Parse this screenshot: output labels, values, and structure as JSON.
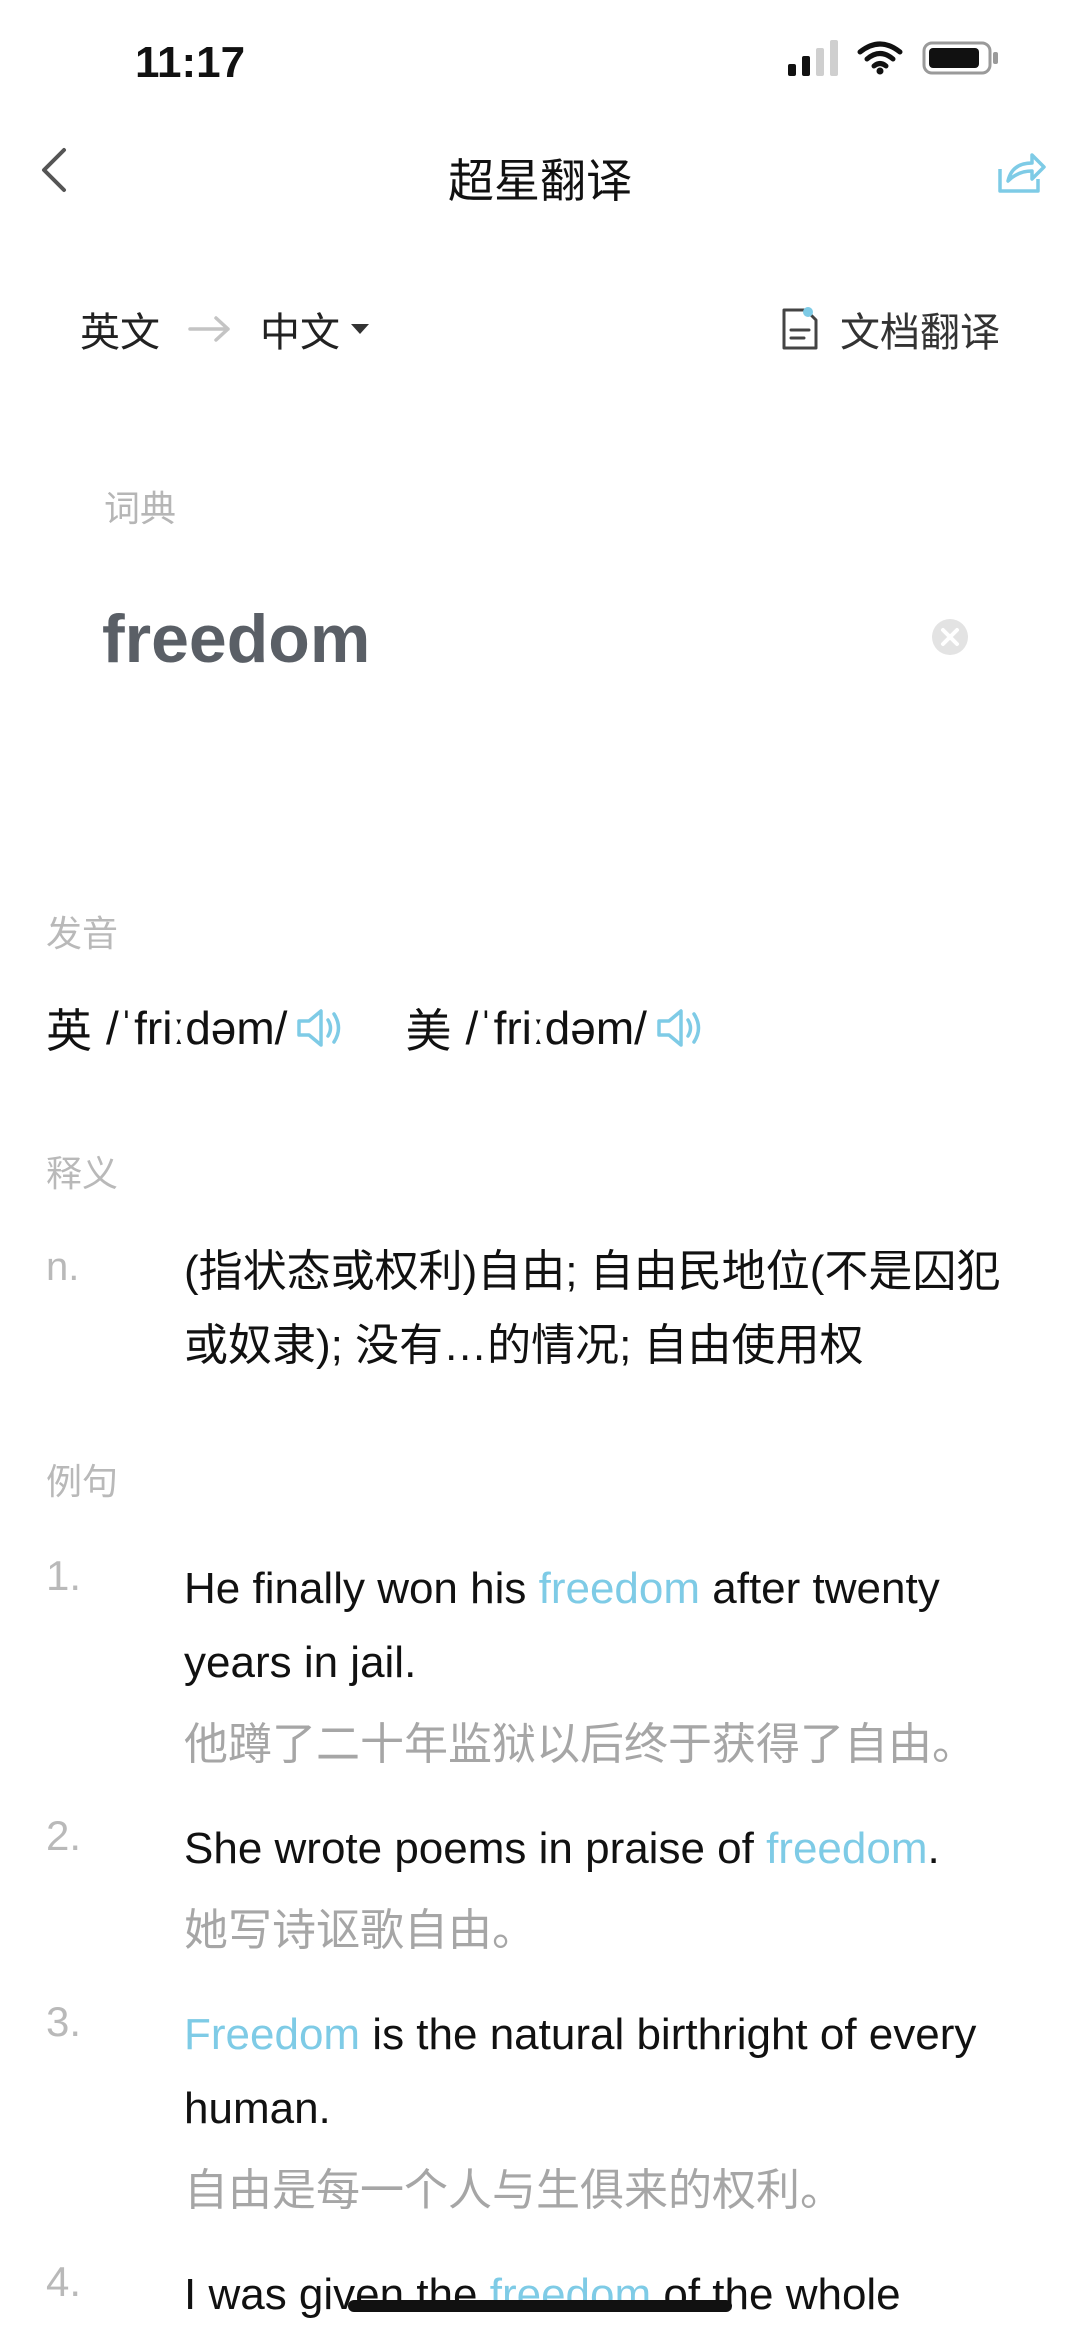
{
  "status": {
    "time": "11:17"
  },
  "nav": {
    "title": "超星翻译"
  },
  "lang": {
    "from": "英文",
    "to": "中文",
    "doc_translate": "文档翻译"
  },
  "input": {
    "label": "词典",
    "word": "freedom"
  },
  "sections": {
    "pronunciation": "发音",
    "definition": "释义",
    "examples": "例句"
  },
  "pronunciations": [
    {
      "region": "英",
      "ipa": "/ˈfriːdəm/"
    },
    {
      "region": "美",
      "ipa": "/ˈfriːdəm/"
    }
  ],
  "definition": {
    "pos": "n.",
    "text": "(指状态或权利)自由; 自由民地位(不是囚犯或奴隶); 没有…的情况; 自由使用权"
  },
  "examples": [
    {
      "num": "1.",
      "before": "He finally won his ",
      "highlight": "freedom",
      "after": " after twenty years in jail.",
      "zh": "他蹲了二十年监狱以后终于获得了自由。"
    },
    {
      "num": "2.",
      "before": "She wrote poems in praise of ",
      "highlight": "freedom",
      "after": ".",
      "zh": "她写诗讴歌自由。"
    },
    {
      "num": "3.",
      "before": "",
      "highlight": "Freedom",
      "after": " is the natural birthright of every human.",
      "zh": "自由是每一个人与生俱来的权利。"
    },
    {
      "num": "4.",
      "before": "I was given the ",
      "highlight": "freedom",
      "after": " of the whole",
      "zh": ""
    }
  ],
  "colors": {
    "accent": "#7ecbe6",
    "muted": "#b9b9b9",
    "text": "#111111"
  }
}
